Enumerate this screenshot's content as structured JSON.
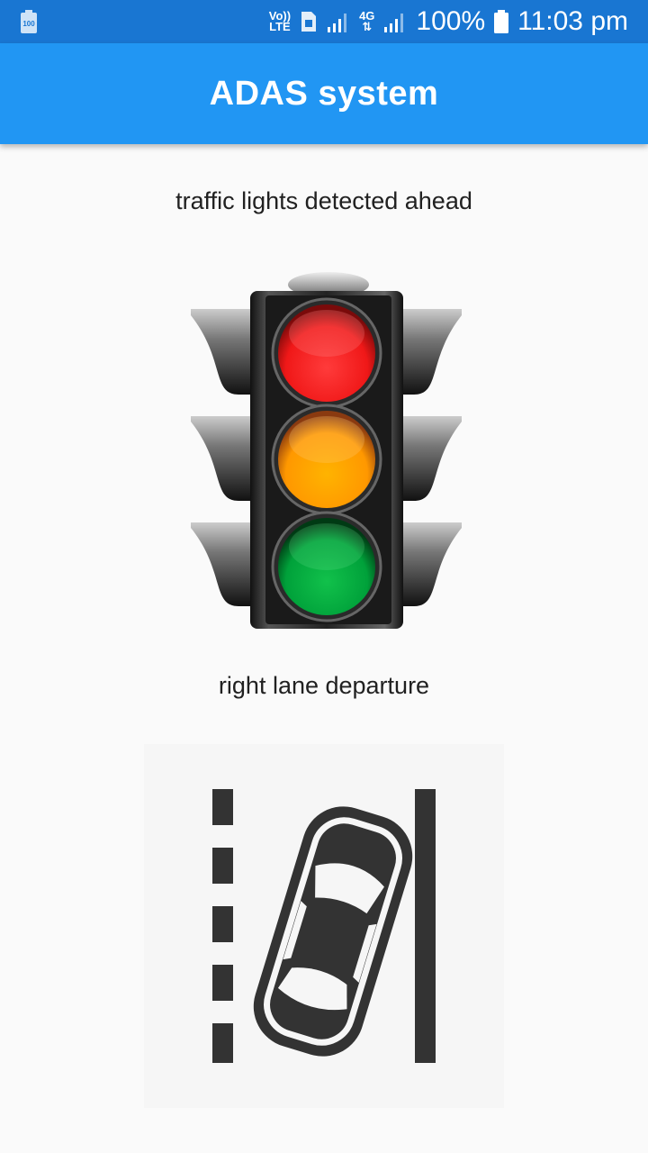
{
  "status_bar": {
    "battery_small": "100",
    "volte_top": "Vo))",
    "volte_bottom": "LTE",
    "network": "4G",
    "battery_percent": "100%",
    "time": "11:03 pm"
  },
  "app_bar": {
    "title": "ADAS system"
  },
  "alerts": [
    {
      "label": "traffic lights detected ahead",
      "icon": "traffic-light-icon"
    },
    {
      "label": "right lane departure",
      "icon": "lane-departure-icon"
    }
  ],
  "colors": {
    "status_bar": "#1976d2",
    "app_bar": "#2196f3",
    "background": "#fafafa",
    "light_red": "#ff2a2a",
    "light_amber": "#ffa000",
    "light_green": "#00b140",
    "icon_dark": "#333333"
  }
}
